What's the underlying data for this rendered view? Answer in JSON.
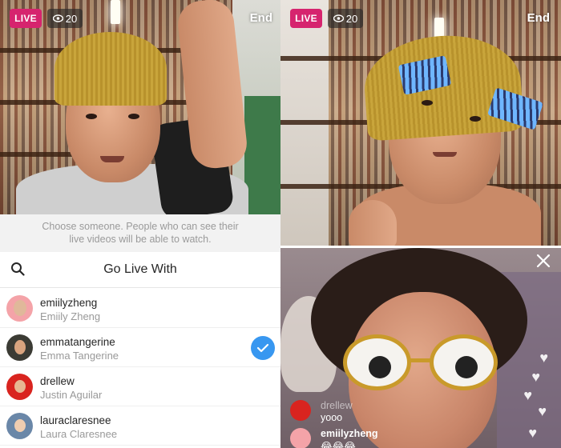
{
  "left": {
    "live_label": "LIVE",
    "viewer_count": "20",
    "end_label": "End",
    "hint_line1": "Choose someone. People who can see their",
    "hint_line2": "live videos will be able to watch.",
    "sheet_title": "Go Live With",
    "users": [
      {
        "username": "emiilyzheng",
        "fullname": "Emiily Zheng",
        "selected": false,
        "avatar_color": "#f4a3a8"
      },
      {
        "username": "emmatangerine",
        "fullname": "Emma Tangerine",
        "selected": true,
        "avatar_color": "#3b3b34"
      },
      {
        "username": "drellew",
        "fullname": "Justin Aguilar",
        "selected": false,
        "avatar_color": "#d9241f"
      },
      {
        "username": "lauraclaresnee",
        "fullname": "Laura Claresnee",
        "selected": false,
        "avatar_color": "#6a87a8"
      }
    ]
  },
  "right": {
    "live_label": "LIVE",
    "viewer_count": "20",
    "end_label": "End",
    "comments": [
      {
        "username": "drellew",
        "text": "yooo"
      },
      {
        "username": "emiilyzheng",
        "text": "😂😂😂"
      }
    ]
  },
  "colors": {
    "live_badge": "#d6246e",
    "check_blue": "#3897f0",
    "hint_bg": "#f2f2f2"
  },
  "icons": [
    "eye-icon",
    "search-icon",
    "check-icon",
    "close-icon",
    "heart-icon"
  ]
}
